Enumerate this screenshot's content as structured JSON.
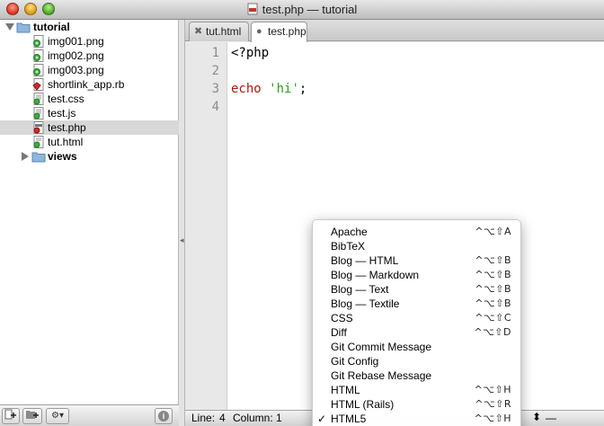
{
  "window": {
    "title": "test.php — tutorial"
  },
  "sidebar": {
    "root": {
      "name": "tutorial"
    },
    "items": [
      {
        "name": "img001.png",
        "icon": "image-file-icon"
      },
      {
        "name": "img002.png",
        "icon": "image-file-icon"
      },
      {
        "name": "img003.png",
        "icon": "image-file-icon"
      },
      {
        "name": "shortlink_app.rb",
        "icon": "ruby-file-icon"
      },
      {
        "name": "test.css",
        "icon": "css-file-icon"
      },
      {
        "name": "test.js",
        "icon": "js-file-icon"
      },
      {
        "name": "test.php",
        "icon": "php-file-icon",
        "selected": true
      },
      {
        "name": "tut.html",
        "icon": "html-file-icon"
      }
    ],
    "folder": {
      "name": "views"
    },
    "footer": {
      "add_file": "+",
      "add_folder": "+",
      "settings": "⚙▾",
      "info": "i"
    }
  },
  "tabs": [
    {
      "label": "tut.html",
      "glyph": "✖"
    },
    {
      "label": "test.php",
      "glyph": "●",
      "active": true
    }
  ],
  "editor": {
    "line_numbers": [
      "1",
      "2",
      "3",
      "4"
    ],
    "lines": {
      "l1": "<?php",
      "l3_kw": "echo",
      "l3_str": "'hi'",
      "l3_end": ";"
    }
  },
  "statusbar": {
    "line_label": "Line:",
    "line_value": "4",
    "column_label": "Column:",
    "column_value": "1",
    "stepper": "⬍",
    "dash": "—"
  },
  "language_menu": {
    "items": [
      {
        "label": "Apache",
        "shortcut": "^⌥⇧A"
      },
      {
        "label": "BibTeX",
        "shortcut": ""
      },
      {
        "label": "Blog — HTML",
        "shortcut": "^⌥⇧B"
      },
      {
        "label": "Blog — Markdown",
        "shortcut": "^⌥⇧B"
      },
      {
        "label": "Blog — Text",
        "shortcut": "^⌥⇧B"
      },
      {
        "label": "Blog — Textile",
        "shortcut": "^⌥⇧B"
      },
      {
        "label": "CSS",
        "shortcut": "^⌥⇧C"
      },
      {
        "label": "Diff",
        "shortcut": "^⌥⇧D"
      },
      {
        "label": "Git Commit Message",
        "shortcut": ""
      },
      {
        "label": "Git Config",
        "shortcut": ""
      },
      {
        "label": "Git Rebase Message",
        "shortcut": ""
      },
      {
        "label": "HTML",
        "shortcut": "^⌥⇧H"
      },
      {
        "label": "HTML (Rails)",
        "shortcut": "^⌥⇧R"
      },
      {
        "label": "HTML5",
        "shortcut": "^⌥⇧H",
        "checked": "✓"
      }
    ]
  }
}
